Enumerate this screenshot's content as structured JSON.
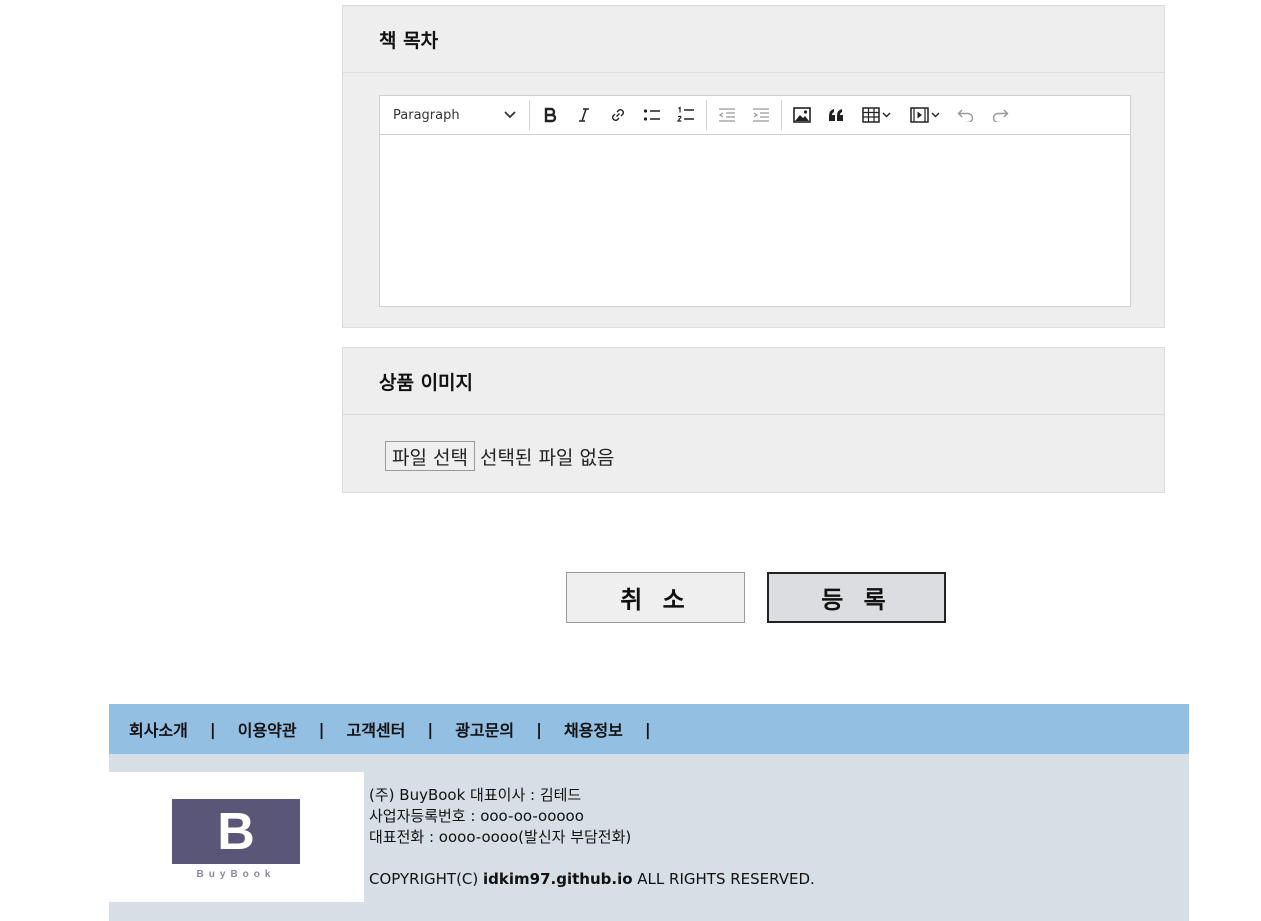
{
  "toc_section": {
    "title": "책 목차",
    "editor": {
      "paragraph_label": "Paragraph",
      "toolbar_icons": [
        "bold-icon",
        "italic-icon",
        "link-icon",
        "bulleted-list-icon",
        "numbered-list-icon",
        "outdent-icon",
        "indent-icon",
        "image-icon",
        "blockquote-icon",
        "table-icon",
        "media-icon",
        "undo-icon",
        "redo-icon"
      ]
    }
  },
  "image_section": {
    "title": "상품 이미지",
    "file_button": "파일 선택",
    "file_status": "선택된 파일 없음"
  },
  "actions": {
    "cancel_label": "취 소",
    "submit_label": "등 록"
  },
  "footer": {
    "nav": [
      "회사소개",
      "이용약관",
      "고객센터",
      "광고문의",
      "채용정보"
    ],
    "separator": "|",
    "logo_letter": "B",
    "logo_text": "BuyBook",
    "company_line": "(주) BuyBook 대표이사 : 김테드",
    "biz_number_line": "사업자등록번호 : ooo-oo-ooooo",
    "phone_line": "대표전화 : oooo-oooo(발신자 부담전화)",
    "copyright_prefix": "COPYRIGHT(C) ",
    "copyright_site": "idkim97.github.io",
    "copyright_suffix": " ALL RIGHTS RESERVED."
  },
  "colors": {
    "panel_bg": "#eeeeee",
    "footer_nav_bg": "#93bfe3",
    "footer_info_bg": "#d6dfe6",
    "logo_bg": "#5a5678"
  }
}
